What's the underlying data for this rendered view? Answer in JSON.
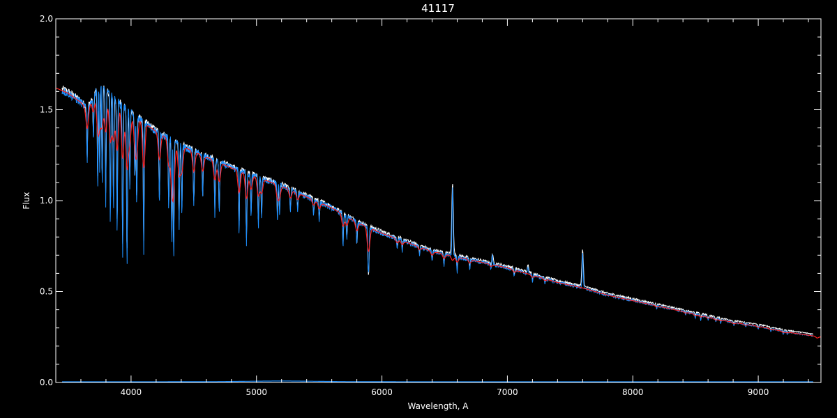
{
  "chart_data": {
    "type": "line",
    "title": "41117",
    "xlabel": "Wavelength, A",
    "ylabel": "Flux",
    "xlim": [
      3400,
      9500
    ],
    "ylim": [
      0.0,
      2.0
    ],
    "xticks": [
      4000,
      5000,
      6000,
      7000,
      8000,
      9000
    ],
    "xtick_labels": [
      "4000",
      "5000",
      "6000",
      "7000",
      "8000",
      "9000"
    ],
    "yticks": [
      0.0,
      0.5,
      1.0,
      1.5,
      2.0
    ],
    "ytick_labels": [
      "0.0",
      "0.5",
      "1.0",
      "1.5",
      "2.0"
    ],
    "grid": false,
    "colors": {
      "background": "#000000",
      "axes": "#ffffff",
      "observed": "#ffffff",
      "model": "#ff2020",
      "fit": "#1e90ff",
      "error": "#1e90ff"
    },
    "continuum": {
      "x": [
        3400,
        3500,
        3600,
        3650,
        3700,
        3750,
        3800,
        3900,
        4000,
        4200,
        4400,
        4600,
        4800,
        5000,
        5200,
        5400,
        5600,
        5800,
        6000,
        6200,
        6400,
        6600,
        6800,
        7000,
        7200,
        7400,
        7600,
        7800,
        8000,
        8200,
        8400,
        8600,
        8800,
        9000,
        9200,
        9500
      ],
      "y": [
        1.62,
        1.59,
        1.54,
        1.5,
        1.57,
        1.64,
        1.6,
        1.54,
        1.48,
        1.38,
        1.3,
        1.24,
        1.18,
        1.13,
        1.08,
        1.02,
        0.96,
        0.88,
        0.82,
        0.77,
        0.72,
        0.69,
        0.66,
        0.63,
        0.59,
        0.55,
        0.52,
        0.48,
        0.45,
        0.42,
        0.39,
        0.36,
        0.33,
        0.31,
        0.28,
        0.25
      ]
    },
    "absorption_lines": [
      {
        "x": 3650,
        "depth": 0.2
      },
      {
        "x": 3700,
        "depth": 0.15
      },
      {
        "x": 3734,
        "depth": 0.35
      },
      {
        "x": 3750,
        "depth": 0.3
      },
      {
        "x": 3770,
        "depth": 0.35
      },
      {
        "x": 3798,
        "depth": 0.4
      },
      {
        "x": 3835,
        "depth": 0.45
      },
      {
        "x": 3860,
        "depth": 0.4
      },
      {
        "x": 3889,
        "depth": 0.5
      },
      {
        "x": 3933,
        "depth": 0.55
      },
      {
        "x": 3968,
        "depth": 0.6
      },
      {
        "x": 3990,
        "depth": 0.3
      },
      {
        "x": 4030,
        "depth": 0.25
      },
      {
        "x": 4045,
        "depth": 0.35
      },
      {
        "x": 4101,
        "depth": 0.5
      },
      {
        "x": 4226,
        "depth": 0.3
      },
      {
        "x": 4300,
        "depth": 0.3
      },
      {
        "x": 4325,
        "depth": 0.45
      },
      {
        "x": 4340,
        "depth": 0.5
      },
      {
        "x": 4383,
        "depth": 0.35
      },
      {
        "x": 4405,
        "depth": 0.3
      },
      {
        "x": 4500,
        "depth": 0.25
      },
      {
        "x": 4571,
        "depth": 0.2
      },
      {
        "x": 4668,
        "depth": 0.25
      },
      {
        "x": 4703,
        "depth": 0.25
      },
      {
        "x": 4861,
        "depth": 0.3
      },
      {
        "x": 4920,
        "depth": 0.35
      },
      {
        "x": 4957,
        "depth": 0.2
      },
      {
        "x": 5015,
        "depth": 0.25
      },
      {
        "x": 5041,
        "depth": 0.2
      },
      {
        "x": 5167,
        "depth": 0.18
      },
      {
        "x": 5184,
        "depth": 0.15
      },
      {
        "x": 5270,
        "depth": 0.12
      },
      {
        "x": 5328,
        "depth": 0.1
      },
      {
        "x": 5455,
        "depth": 0.08
      },
      {
        "x": 5500,
        "depth": 0.1
      },
      {
        "x": 5690,
        "depth": 0.2
      },
      {
        "x": 5720,
        "depth": 0.15
      },
      {
        "x": 5800,
        "depth": 0.15
      },
      {
        "x": 5890,
        "depth": 0.25
      },
      {
        "x": 5896,
        "depth": 0.22
      },
      {
        "x": 6122,
        "depth": 0.08
      },
      {
        "x": 6162,
        "depth": 0.08
      },
      {
        "x": 6300,
        "depth": 0.06
      },
      {
        "x": 6400,
        "depth": 0.08
      },
      {
        "x": 6495,
        "depth": 0.1
      },
      {
        "x": 6563,
        "depth": 0.1
      },
      {
        "x": 6600,
        "depth": 0.12
      },
      {
        "x": 6700,
        "depth": 0.08
      },
      {
        "x": 6870,
        "depth": 0.05
      },
      {
        "x": 7055,
        "depth": 0.06
      },
      {
        "x": 7200,
        "depth": 0.06
      },
      {
        "x": 7300,
        "depth": 0.05
      },
      {
        "x": 8190,
        "depth": 0.04
      },
      {
        "x": 8420,
        "depth": 0.04
      },
      {
        "x": 8498,
        "depth": 0.06
      },
      {
        "x": 8542,
        "depth": 0.07
      },
      {
        "x": 8600,
        "depth": 0.05
      },
      {
        "x": 8662,
        "depth": 0.06
      },
      {
        "x": 8700,
        "depth": 0.05
      },
      {
        "x": 8806,
        "depth": 0.06
      },
      {
        "x": 8900,
        "depth": 0.05
      },
      {
        "x": 9000,
        "depth": 0.06
      },
      {
        "x": 9100,
        "depth": 0.04
      },
      {
        "x": 9200,
        "depth": 0.05
      },
      {
        "x": 9230,
        "depth": 0.04
      },
      {
        "x": 9470,
        "depth": 0.1
      }
    ],
    "emission_features": [
      {
        "x": 6563,
        "height": 0.45
      },
      {
        "x": 6880,
        "height": 0.05
      },
      {
        "x": 7165,
        "height": 0.04
      },
      {
        "x": 7600,
        "height": 0.2
      }
    ],
    "error_floor": 0.0
  }
}
